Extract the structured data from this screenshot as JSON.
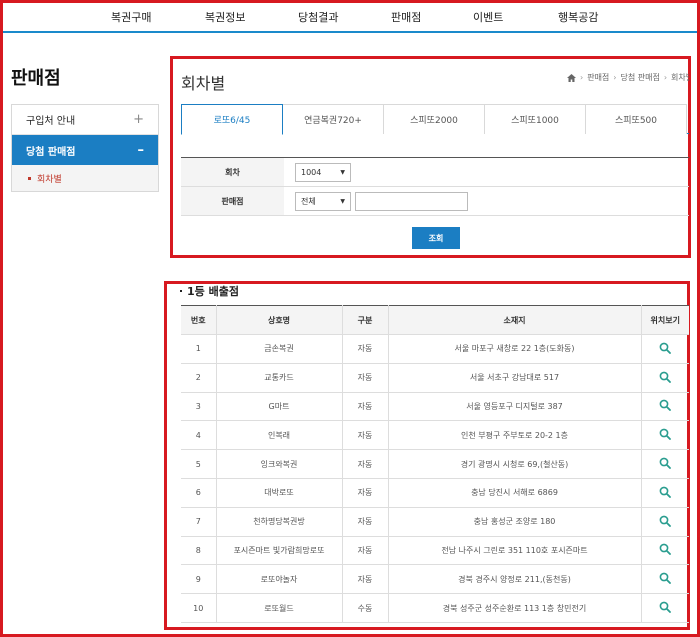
{
  "top_nav": [
    "복권구매",
    "복권정보",
    "당첨결과",
    "판매점",
    "이벤트",
    "행복공감"
  ],
  "page_heading": "판매점",
  "sidebar": {
    "items": [
      {
        "label": "구입처 안내",
        "sign": "+"
      },
      {
        "label": "당첨 판매점",
        "sign": "–"
      }
    ],
    "sub_item": "회차별"
  },
  "section_title": "회차별",
  "breadcrumb": [
    "판매점",
    "당첨 판매점",
    "회차별"
  ],
  "tabs": [
    "로또6/45",
    "연금복권720+",
    "스피또2000",
    "스피또1000",
    "스피또500"
  ],
  "search": {
    "round_label": "회차",
    "round_value": "1004",
    "store_label": "판매점",
    "store_value": "전체",
    "button": "조회"
  },
  "list_title": "1등 배출점",
  "table": {
    "headers": [
      "번호",
      "상호명",
      "구분",
      "소재지",
      "위치보기"
    ],
    "rows": [
      {
        "no": "1",
        "name": "금손복권",
        "type": "자동",
        "address": "서울 마포구 새창로 22 1층(도화동)"
      },
      {
        "no": "2",
        "name": "교통카드",
        "type": "자동",
        "address": "서울 서초구 강남대로 517"
      },
      {
        "no": "3",
        "name": "G마트",
        "type": "자동",
        "address": "서울 영등포구 디지털로 387"
      },
      {
        "no": "4",
        "name": "인복래",
        "type": "자동",
        "address": "인천 부평구 주부토로 20-2 1층"
      },
      {
        "no": "5",
        "name": "잉크와복권",
        "type": "자동",
        "address": "경기 광명시 시청로 69,(철산동)"
      },
      {
        "no": "6",
        "name": "대박로또",
        "type": "자동",
        "address": "충남 당진시 서해로 6869"
      },
      {
        "no": "7",
        "name": "천하명당복권방",
        "type": "자동",
        "address": "충남 홍성군 조양로 180"
      },
      {
        "no": "8",
        "name": "포시즌마트 빛가람희망로또",
        "type": "자동",
        "address": "전남 나주시 그린로 351 110호 포시즌마트"
      },
      {
        "no": "9",
        "name": "로또야놀자",
        "type": "자동",
        "address": "경북 경주시 양정로 211,(동천동)"
      },
      {
        "no": "10",
        "name": "로또월드",
        "type": "수동",
        "address": "경북 성주군 성주순환로 113 1층 창민전기"
      }
    ]
  },
  "colors": {
    "accent": "#1b7ec3",
    "highlight_frame": "#d71920",
    "location_icon": "#2a9d8f"
  }
}
